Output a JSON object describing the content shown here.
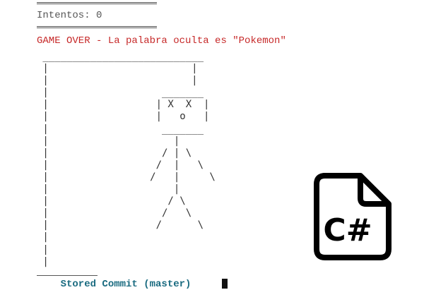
{
  "console": {
    "attempts_text": "Intentos: 0",
    "game_over_text": "GAME OVER - La palabra oculta es \"Pokemon\"",
    "hangman_art": [
      " ___________________________",
      " |                        |",
      " |                        |",
      " |                   _______",
      " |                  | X  X  |",
      " |                  |   o   |",
      " |                   _______",
      " |                     |",
      " |                   / | \\",
      " |                  /  |   \\",
      " |                 /   |     \\",
      " |                     |",
      " |                    / \\",
      " |                   /   \\",
      " |                  /      \\",
      " |",
      " |",
      " |"
    ],
    "bottom_text": "    Stored Commit (master)"
  },
  "icons": {
    "logo": "csharp-file-icon",
    "logo_text": "C#"
  },
  "colors": {
    "text_gray": "#555555",
    "game_over_red": "#c62828",
    "bottom_teal": "#1a6b80",
    "icon_black": "#000000"
  }
}
